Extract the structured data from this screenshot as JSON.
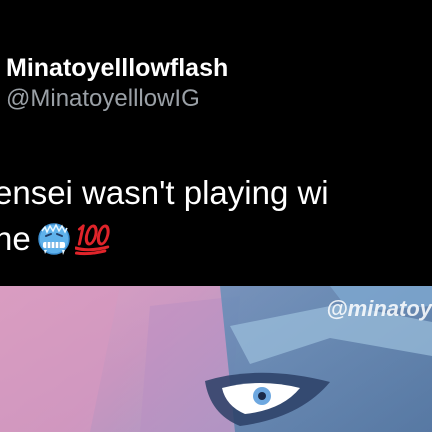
{
  "tweet": {
    "display_name": "Minatoyelllowflash",
    "handle": "@MinatoyelllowIG",
    "text_line_1": "ensei wasn't playing wi",
    "text_line_2": "ne",
    "emojis": [
      "cold-face-emoji",
      "hundred-points-emoji"
    ]
  },
  "video": {
    "watermark": "@minatoy"
  },
  "colors": {
    "background": "#000000",
    "text_primary": "#ffffff",
    "text_secondary": "#9aa0a6",
    "hundred_red": "#e0242a"
  }
}
